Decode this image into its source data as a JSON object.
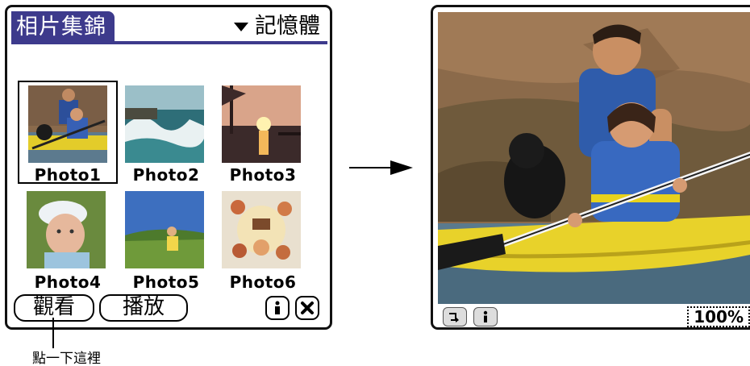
{
  "left_screen": {
    "title": "相片集錦",
    "category": "記憶體",
    "photos": [
      {
        "caption": "Photo1"
      },
      {
        "caption": "Photo2"
      },
      {
        "caption": "Photo3"
      },
      {
        "caption": "Photo4"
      },
      {
        "caption": "Photo5"
      },
      {
        "caption": "Photo6"
      }
    ],
    "buttons": {
      "view": "觀看",
      "play": "播放",
      "info_icon": "info-icon",
      "close_icon": "close-icon"
    }
  },
  "callout": "點一下這裡",
  "right_screen": {
    "zoom": "100%",
    "rotate_icon": "rotate-icon",
    "info_icon": "info-icon"
  },
  "colors": {
    "title_bar": "#3d3a8c",
    "border": "#111111"
  }
}
